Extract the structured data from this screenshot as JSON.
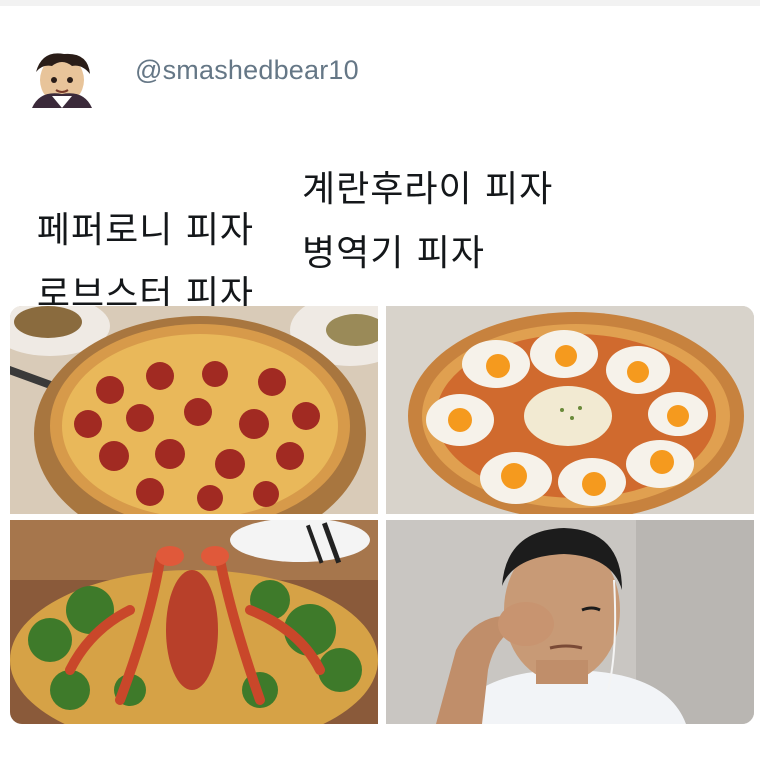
{
  "tweet": {
    "handle": "@smashedbear10",
    "lines": [
      {
        "left": "페퍼로니 피자",
        "right": "계란후라이 피자"
      },
      {
        "left": "로브스터 피자",
        "right": "병역기 피자"
      }
    ]
  },
  "images": [
    {
      "subject": "pepperoni-pizza"
    },
    {
      "subject": "fried-egg-pizza"
    },
    {
      "subject": "lobster-pizza"
    },
    {
      "subject": "crying-man"
    }
  ],
  "colors": {
    "handle": "#657786",
    "text": "#14171a",
    "background": "#ffffff"
  }
}
